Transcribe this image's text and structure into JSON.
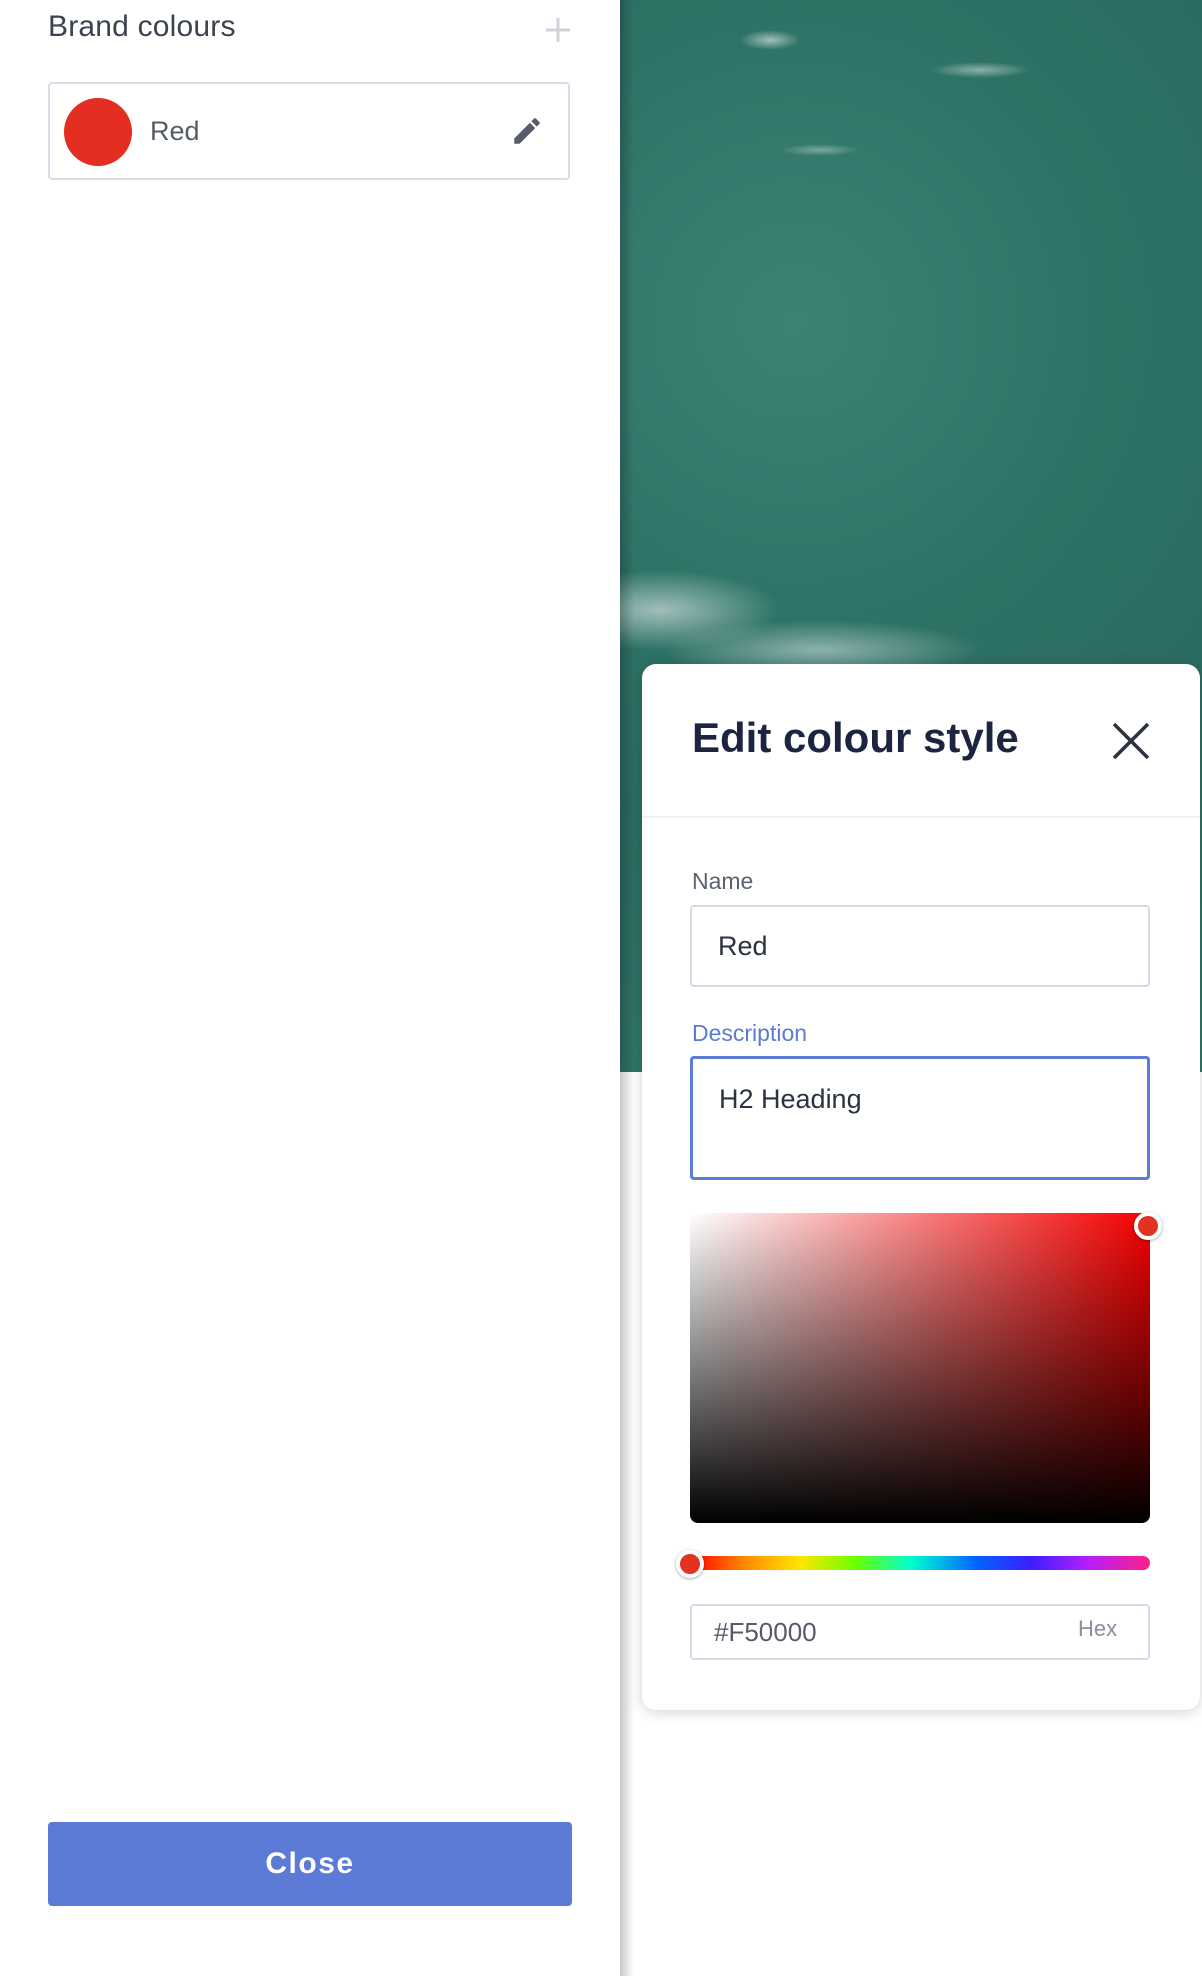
{
  "sidebar": {
    "title": "Brand colours",
    "colours": [
      {
        "name": "Red",
        "swatch_color": "#e52e22"
      }
    ],
    "close_label": "Close",
    "close_color": "#5b7bd6"
  },
  "dialog": {
    "title": "Edit colour style",
    "name_label": "Name",
    "name_value": "Red",
    "description_label": "Description",
    "description_value": "H2 Heading",
    "picker": {
      "hue_color": "#F50000",
      "hex_value": "#F50000",
      "hex_label": "Hex"
    }
  },
  "icons": {
    "add": "plus-icon",
    "edit": "pencil-icon",
    "close": "close-icon"
  },
  "colors": {
    "accent": "#5b7bd6",
    "text_dark": "#1c2540",
    "border": "#d5dbe6"
  }
}
